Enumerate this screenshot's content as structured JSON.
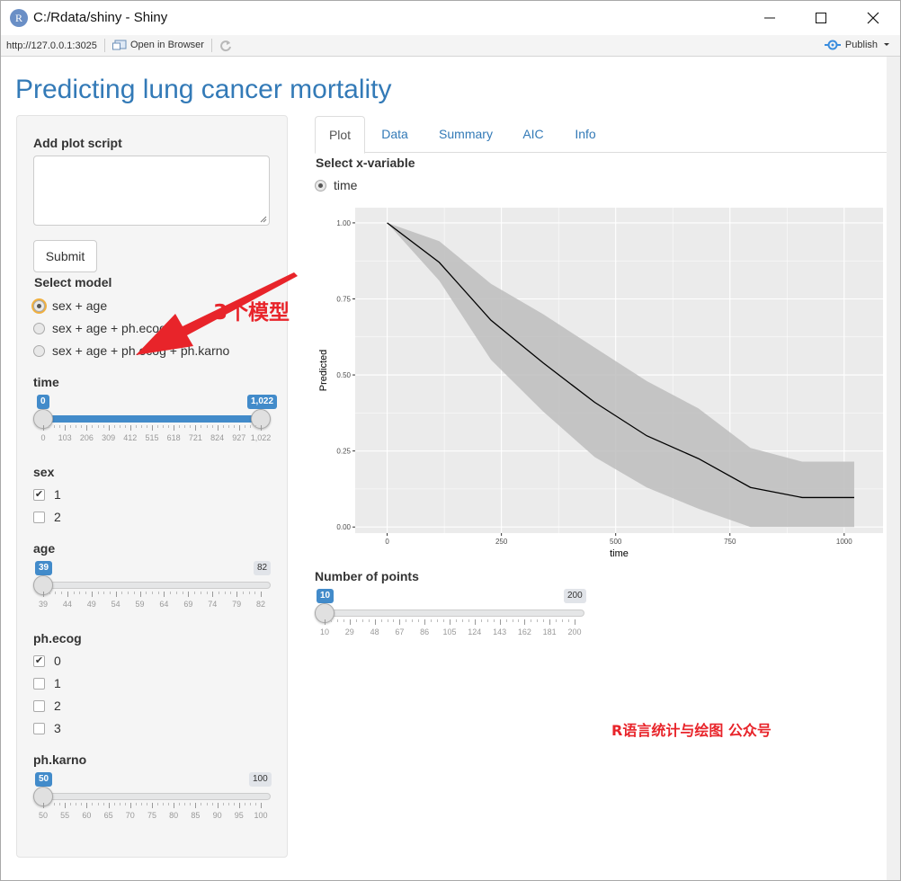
{
  "window": {
    "title": "C:/Rdata/shiny - Shiny",
    "app_icon_letter": "R"
  },
  "addressbar": {
    "url": "http://127.0.0.1:3025",
    "open_in_browser": "Open in Browser",
    "publish": "Publish"
  },
  "page": {
    "title": "Predicting lung cancer mortality"
  },
  "sidebar": {
    "plot_script_label": "Add plot script",
    "plot_script_value": "",
    "submit_label": "Submit",
    "select_model_label": "Select model",
    "models": [
      {
        "label": "sex + age",
        "selected": true
      },
      {
        "label": "sex + age + ph.ecog",
        "selected": false
      },
      {
        "label": "sex + age + ph.ecog + ph.karno",
        "selected": false
      }
    ],
    "time": {
      "label": "time",
      "min": 0,
      "max": 1022,
      "from": 0,
      "to": 1022,
      "from_label": "0",
      "to_label": "1,022",
      "ticks": [
        "0",
        "103",
        "206",
        "309",
        "412",
        "515",
        "618",
        "721",
        "824",
        "927",
        "1,022"
      ]
    },
    "sex": {
      "label": "sex",
      "options": [
        {
          "label": "1",
          "checked": true
        },
        {
          "label": "2",
          "checked": false
        }
      ]
    },
    "age": {
      "label": "age",
      "min": 39,
      "max": 82,
      "value": 39,
      "value_label": "39",
      "max_label": "82",
      "ticks": [
        "39",
        "44",
        "49",
        "54",
        "59",
        "64",
        "69",
        "74",
        "79",
        "82"
      ]
    },
    "ph_ecog": {
      "label": "ph.ecog",
      "options": [
        {
          "label": "0",
          "checked": true
        },
        {
          "label": "1",
          "checked": false
        },
        {
          "label": "2",
          "checked": false
        },
        {
          "label": "3",
          "checked": false
        }
      ]
    },
    "ph_karno": {
      "label": "ph.karno",
      "min": 50,
      "max": 100,
      "value": 50,
      "value_label": "50",
      "max_label": "100",
      "ticks": [
        "50",
        "55",
        "60",
        "65",
        "70",
        "75",
        "80",
        "85",
        "90",
        "95",
        "100"
      ]
    }
  },
  "tabs": [
    {
      "label": "Plot",
      "active": true
    },
    {
      "label": "Data",
      "active": false
    },
    {
      "label": "Summary",
      "active": false
    },
    {
      "label": "AIC",
      "active": false
    },
    {
      "label": "Info",
      "active": false
    }
  ],
  "main": {
    "x_var_label": "Select x-variable",
    "x_var_option": "time",
    "points": {
      "label": "Number of points",
      "min": 10,
      "max": 200,
      "value": 10,
      "value_label": "10",
      "max_label": "200",
      "ticks": [
        "10",
        "29",
        "48",
        "67",
        "86",
        "105",
        "124",
        "143",
        "162",
        "181",
        "200"
      ]
    }
  },
  "chart_data": {
    "type": "line",
    "xlabel": "time",
    "ylabel": "Predicted",
    "xlim": [
      -70,
      1085
    ],
    "ylim": [
      -0.02,
      1.05
    ],
    "xticks": [
      0,
      250,
      500,
      750,
      1000
    ],
    "yticks": [
      0.0,
      0.25,
      0.5,
      0.75,
      1.0
    ],
    "ytick_labels": [
      "0.00",
      "0.25",
      "0.50",
      "0.75",
      "1.00"
    ],
    "x": [
      0,
      114,
      227,
      341,
      454,
      568,
      681,
      795,
      908,
      1022
    ],
    "predicted": [
      1.0,
      0.87,
      0.68,
      0.54,
      0.41,
      0.3,
      0.225,
      0.13,
      0.097,
      0.097
    ],
    "lower": [
      1.0,
      0.81,
      0.55,
      0.38,
      0.23,
      0.13,
      0.06,
      0.0,
      0.0,
      0.0
    ],
    "upper": [
      1.0,
      0.94,
      0.8,
      0.7,
      0.59,
      0.48,
      0.39,
      0.26,
      0.215,
      0.215
    ],
    "colors": {
      "panel": "#ebebeb",
      "band": "#bdbdbd",
      "line": "#000000",
      "grid": "#ffffff"
    }
  },
  "annotations": {
    "model_count": "3个模型",
    "watermark": "R语言统计与绘图 公众号",
    "color": "#e8242a"
  }
}
